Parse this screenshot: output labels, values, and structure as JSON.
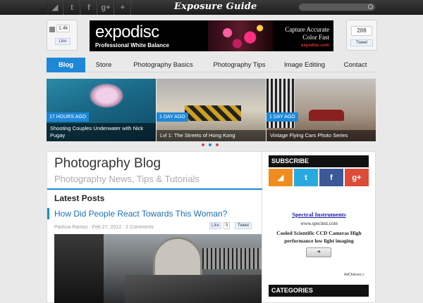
{
  "topbar": {
    "logo": "Exposure Guide",
    "social": [
      {
        "icon": "rss-icon",
        "glyph": "◢"
      },
      {
        "icon": "twitter-icon",
        "glyph": "t"
      },
      {
        "icon": "facebook-icon",
        "glyph": "f"
      },
      {
        "icon": "google-plus-icon",
        "glyph": "g+"
      },
      {
        "icon": "plus-icon",
        "glyph": "+"
      }
    ]
  },
  "header": {
    "fb_count": "1.4k",
    "fb_like": "Like",
    "tw_count": "288",
    "tw_tweet": "Tweet",
    "ad": {
      "logo": "expodisc",
      "sub": "Professional White Balance",
      "line1": "Capture Accurate",
      "line2": "Color Fast",
      "url": "expodisc.com"
    }
  },
  "nav": {
    "items": [
      {
        "label": "Blog",
        "active": true
      },
      {
        "label": "Store",
        "active": false
      },
      {
        "label": "Photography Basics",
        "active": false
      },
      {
        "label": "Photography Tips",
        "active": false
      },
      {
        "label": "Image Editing",
        "active": false
      },
      {
        "label": "Contact",
        "active": false
      }
    ]
  },
  "slider": {
    "slides": [
      {
        "badge": "17 HOURS AGO",
        "caption": "Shooting Couples Underwater with Nick Pugay"
      },
      {
        "badge": "1 DAY AGO",
        "caption": "Lvl 1: The Streets of Hong Kong"
      },
      {
        "badge": "1 DAY AGO",
        "caption": "Vintage Flying Cars Photo Series"
      }
    ]
  },
  "main": {
    "title": "Photography Blog",
    "subtitle": "Photography News, Tips & Tutorials",
    "section": "Latest Posts",
    "post": {
      "title": "How Did People React Towards This Woman?",
      "meta": "Patricia Ramos · Feb 27, 2013 · 2 Comments",
      "like": "Like",
      "like_count": "5",
      "tweet": "Tweet"
    }
  },
  "sidebar": {
    "subscribe": "SUBSCRIBE",
    "icons": [
      {
        "name": "rss-subscribe-icon",
        "glyph": "◢"
      },
      {
        "name": "twitter-subscribe-icon",
        "glyph": "t"
      },
      {
        "name": "facebook-subscribe-icon",
        "glyph": "f"
      },
      {
        "name": "google-plus-subscribe-icon",
        "glyph": "g+"
      }
    ],
    "ad": {
      "title": "Spectral Instruments",
      "url": "www.specinst.com",
      "body": "Cooled Scientific CCD Cameras High performance low light imaging",
      "button": "➜",
      "adchoices": "AdChoices ▷"
    },
    "categories": "CATEGORIES"
  },
  "colors": {
    "accent": "#1e88d8",
    "topbar": "#2a2a2a",
    "rss": "#f08c1e",
    "twitter": "#2aa9e0",
    "facebook": "#3b5998",
    "google_plus": "#dd4b39"
  }
}
